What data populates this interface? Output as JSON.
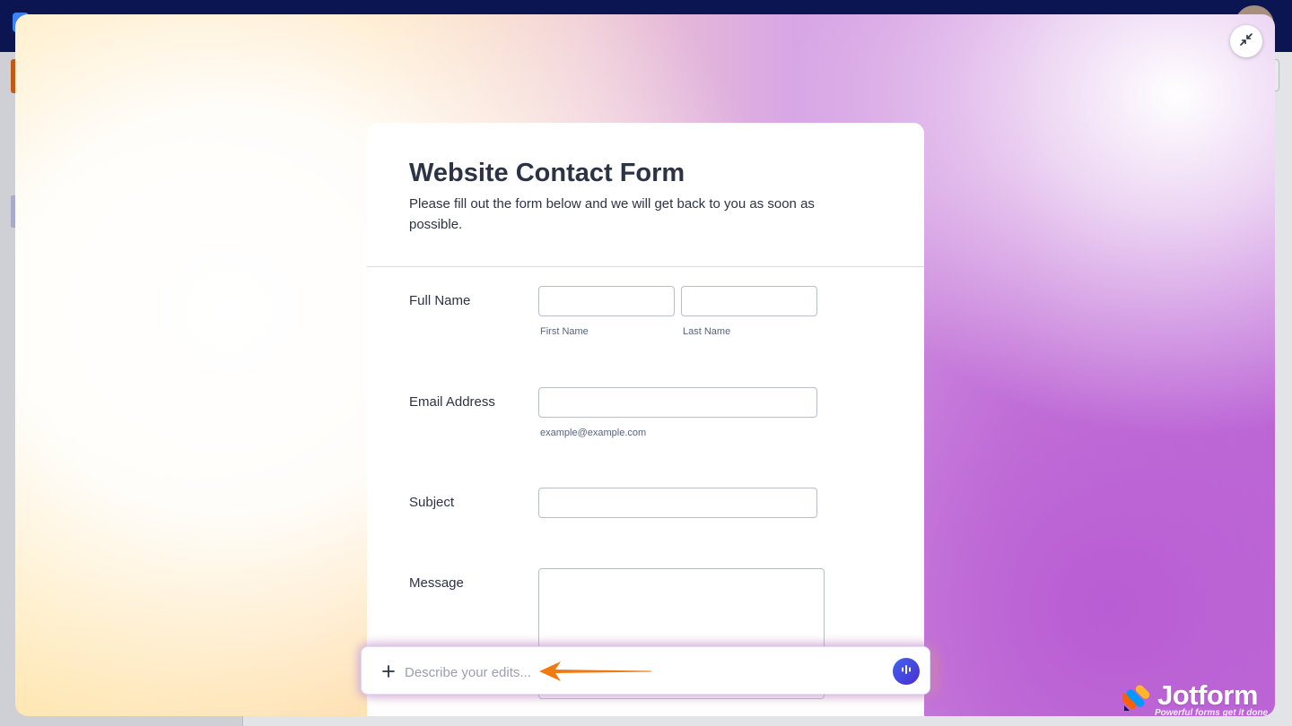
{
  "form": {
    "title": "Website Contact Form",
    "description": "Please fill out the form below and we will get back to you as soon as possible.",
    "fields": {
      "full_name": {
        "label": "Full Name",
        "first_sublabel": "First Name",
        "last_sublabel": "Last Name"
      },
      "email": {
        "label": "Email Address",
        "sublabel": "example@example.com"
      },
      "subject": {
        "label": "Subject"
      },
      "message": {
        "label": "Message"
      }
    }
  },
  "prompt_bar": {
    "placeholder": "Describe your edits..."
  },
  "brand": {
    "name": "Jotform",
    "tagline": "Powerful forms get it done"
  },
  "colors": {
    "accent": "#4b2fd0",
    "arrow": "#f07a12",
    "header_bg": "#0a1551"
  },
  "icons": {
    "collapse": "collapse-icon",
    "plus": "plus-icon",
    "voice": "voice-icon",
    "arrow": "arrow-pointer-icon"
  }
}
